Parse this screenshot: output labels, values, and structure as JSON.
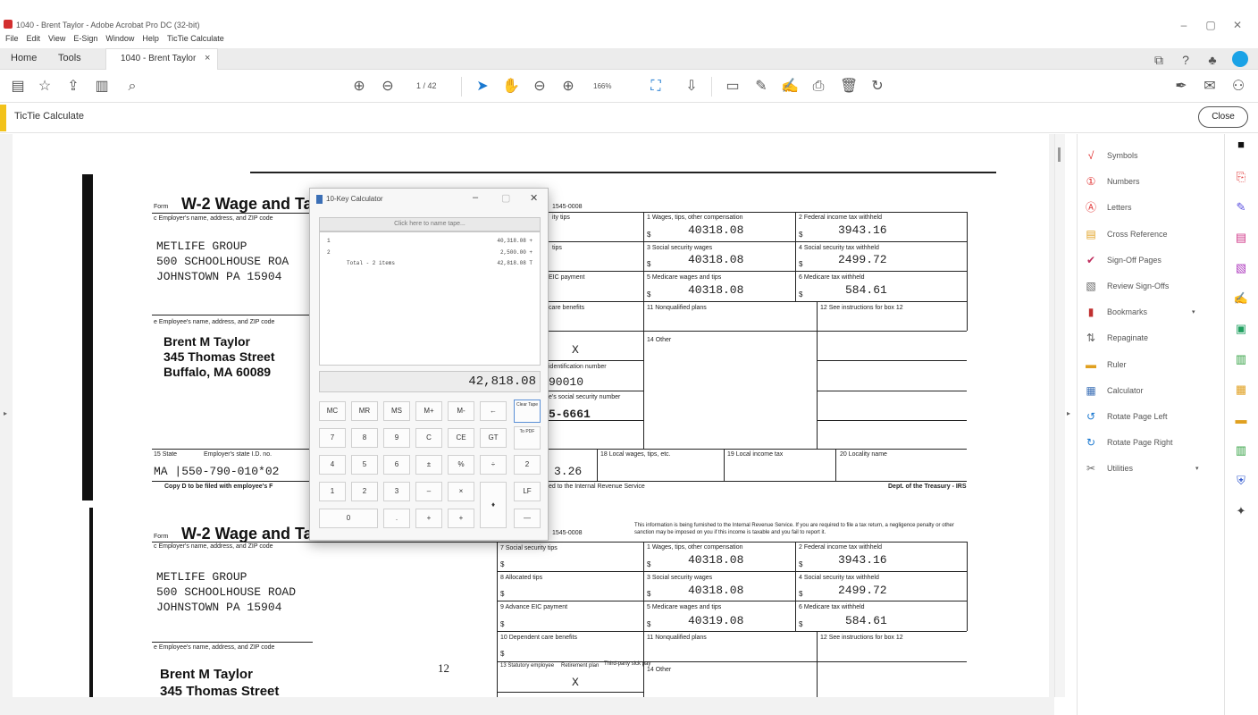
{
  "window": {
    "title": "1040 - Brent Taylor - Adobe Acrobat Pro DC (32-bit)",
    "controls": [
      "–",
      "▢",
      "✕"
    ]
  },
  "menu": [
    "File",
    "Edit",
    "View",
    "E-Sign",
    "Window",
    "Help",
    "TicTie Calculate"
  ],
  "tabs": {
    "home": "Home",
    "tools": "Tools",
    "document": "1040 - Brent Taylor",
    "close_glyph": "×"
  },
  "toolbar": {
    "page_indicator": "1 / 42",
    "zoom": "166%"
  },
  "tool_strip": {
    "label": "TicTie Calculate",
    "close_label": "Close"
  },
  "right_panel": {
    "items": [
      {
        "label": "Symbols",
        "icon": "check-mark-icon",
        "glyph": "√",
        "color": "#e03030"
      },
      {
        "label": "Numbers",
        "icon": "circled-number-icon",
        "glyph": "①",
        "color": "#e03030"
      },
      {
        "label": "Letters",
        "icon": "circled-letter-icon",
        "glyph": "Ⓐ",
        "color": "#e03030"
      },
      {
        "label": "Cross Reference",
        "icon": "cross-reference-icon",
        "glyph": "▤",
        "color": "#e0a020"
      },
      {
        "label": "Sign-Off Pages",
        "icon": "sign-off-icon",
        "glyph": "✔",
        "color": "#c03060"
      },
      {
        "label": "Review Sign-Offs",
        "icon": "review-icon",
        "glyph": "▧",
        "color": "#666666"
      },
      {
        "label": "Bookmarks",
        "icon": "bookmark-icon",
        "glyph": "▮",
        "color": "#c03030"
      },
      {
        "label": "Repaginate",
        "icon": "repaginate-icon",
        "glyph": "⇅",
        "color": "#666666"
      },
      {
        "label": "Ruler",
        "icon": "ruler-icon",
        "glyph": "▬",
        "color": "#e0a020"
      },
      {
        "label": "Calculator",
        "icon": "calculator-icon",
        "glyph": "▦",
        "color": "#3b6fb6"
      },
      {
        "label": "Rotate Page Left",
        "icon": "rotate-left-icon",
        "glyph": "↺",
        "color": "#1a78d0"
      },
      {
        "label": "Rotate Page Right",
        "icon": "rotate-right-icon",
        "glyph": "↻",
        "color": "#1a78d0"
      },
      {
        "label": "Utilities",
        "icon": "utilities-icon",
        "glyph": "✂",
        "color": "#666666"
      }
    ]
  },
  "calculator": {
    "title": "10-Key Calculator",
    "tape_name_placeholder": "Click here to name tape...",
    "tape": [
      {
        "left": "1",
        "right": "40,318.08 +"
      },
      {
        "left": "2",
        "right": "2,500.00 +"
      },
      {
        "left": "Total - 2 items",
        "right": "42,818.08 T"
      }
    ],
    "display": "42,818.08",
    "keys": {
      "row1": [
        "MC",
        "MR",
        "MS",
        "M+",
        "M-",
        "←",
        "Clear Tape"
      ],
      "row2": [
        "7",
        "8",
        "9",
        "C",
        "CE",
        "GT",
        "To PDF"
      ],
      "row3": [
        "4",
        "5",
        "6",
        "±",
        "%",
        "÷",
        "2"
      ],
      "row4": [
        "1",
        "2",
        "3",
        "–",
        "×",
        "LF"
      ],
      "row5": [
        "0",
        ".",
        "+",
        "+",
        "—"
      ],
      "enter": "♦"
    }
  },
  "w2_top": {
    "form_prefix": "Form",
    "title": "W-2 Wage and Ta",
    "omb": "1545-0008",
    "employer_label": "c Employer's name, address, and ZIP code",
    "employer_lines": [
      "METLIFE GROUP",
      "500 SCHOOLHOUSE ROA",
      "JOHNSTOWN PA 15904"
    ],
    "employee_label": "e Employee's name, address, and ZIP code",
    "employee_lines": [
      "Brent M Taylor",
      "345 Thomas Street",
      "Buffalo, MA 60089"
    ],
    "boxes": [
      {
        "label": "1 Wages, tips, other compensation",
        "value": "40318.08"
      },
      {
        "label": "2 Federal income tax withheld",
        "value": "3943.16"
      },
      {
        "label": "3 Social security wages",
        "value": "40318.08"
      },
      {
        "label": "4 Social security tax withheld",
        "value": "2499.72"
      },
      {
        "label": "5 Medicare wages and tips",
        "value": "40318.08"
      },
      {
        "label": "6 Medicare tax withheld",
        "value": "584.61"
      }
    ],
    "ss_tips": "ity tips",
    "tips": "tips",
    "eic": "EIC payment",
    "care": "care benefits",
    "nonqual": "11 Nonqualified plans",
    "other": "14 Other",
    "box12": "12 See instructions for box 12",
    "retirement_x": "X",
    "employer_id_label": "identification number",
    "employer_id": "90010",
    "ssn_label": "e's social security number",
    "ssn": "5-6661",
    "state_label": "15 State",
    "state_id_label": "Employer's state I.D. no.",
    "state_line": "MA |550-790-010*02",
    "local_label": "18 Local wages, tips, etc.",
    "local_tax_label": "19 Local income tax",
    "locality_label": "20 Locality name",
    "state_tax_partial": "3.26",
    "copy_text": "Copy D to be filed with employee's F",
    "irs_text": "ed to the Internal Revenue Service",
    "dept_text": "Dept. of the Treasury - IRS"
  },
  "w2_bottom": {
    "form_prefix": "Form",
    "title": "W-2 Wage and Ta",
    "omb": "1545-0008",
    "notice": "This information is being furnished to the Internal Revenue Service. If you are required to file a tax return, a negligence penalty or other sanction may be imposed on you if this income is taxable and you fail to report it.",
    "employer_label": "c Employer's name, address, and ZIP code",
    "employer_lines": [
      "METLIFE GROUP",
      "500 SCHOOLHOUSE ROAD",
      "JOHNSTOWN PA 15904"
    ],
    "employee_label": "e Employee's name, address, and ZIP code",
    "employee_lines": [
      "Brent M Taylor",
      "345 Thomas Street"
    ],
    "page_marker": "12",
    "boxes": [
      {
        "label": "1 Wages, tips, other compensation",
        "value": "40318.08"
      },
      {
        "label": "2 Federal income tax withheld",
        "value": "3943.16"
      },
      {
        "label": "3 Social security wages",
        "value": "40318.08"
      },
      {
        "label": "4 Social security tax withheld",
        "value": "2499.72"
      },
      {
        "label": "5 Medicare wages and tips",
        "value": "40319.08"
      },
      {
        "label": "6 Medicare tax withheld",
        "value": "584.61"
      }
    ],
    "ss_tips": "7 Social security tips",
    "alloc_tips": "8 Allocated tips",
    "eic": "9 Advance EIC payment",
    "dep_care": "10 Dependent care benefits",
    "nonqual": "11 Nonqualified plans",
    "box12": "12 See instructions for box 12",
    "statutory": "13 Statutory employee",
    "retirement": "Retirement plan",
    "third_party": "Third-party sick pay",
    "retirement_x": "X",
    "other": "14 Other"
  }
}
